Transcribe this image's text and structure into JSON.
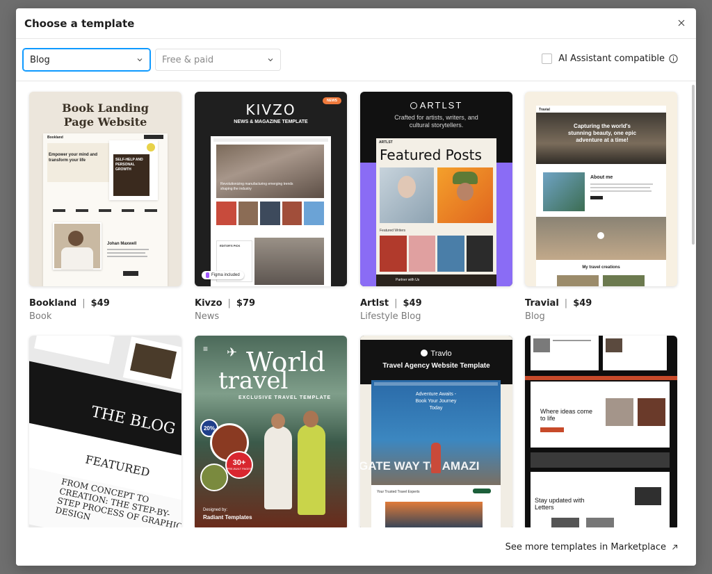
{
  "modal": {
    "title": "Choose a template",
    "close_icon": "close-icon"
  },
  "filters": {
    "category_value": "Blog",
    "price_value": "Free & paid",
    "ai_label": "AI Assistant compatible"
  },
  "templates": [
    {
      "name": "Bookland",
      "price": "$49",
      "category": "Book",
      "thumb": {
        "heading": "Book Landing Page Website",
        "brand": "Bookland",
        "hero": "Empower your mind and transform your life",
        "book_title": "SELF-HELP AND PERSONAL GROWTH",
        "author": "Johan Maxwell"
      }
    },
    {
      "name": "Kivzo",
      "price": "$79",
      "category": "News",
      "thumb": {
        "logo": "KIVZO",
        "subtitle": "NEWS & MAGAZINE TEMPLATE",
        "badge": "NEWS",
        "headline": "Revolutionizing manufacturing emerging trends shaping the industry",
        "editors_pick": "EDITOR'S PICK",
        "figma_badge": "Figma included"
      }
    },
    {
      "name": "Artlst",
      "price": "$49",
      "category": "Lifestyle Blog",
      "thumb": {
        "logo": "ARTLST",
        "tagline": "Crafted for artists, writers, and cultural storytellers.",
        "brand_small": "ARTLST",
        "featured": "Featured Posts",
        "writers": "Featured Writers",
        "partner": "Partner with Us"
      }
    },
    {
      "name": "Travial",
      "price": "$49",
      "category": "Blog",
      "thumb": {
        "brand": "Travial",
        "hero": "Capturing the world's stunning beauty, one epic adventure at a time!",
        "about": "About me",
        "creations": "My travel creations"
      }
    },
    {
      "name": "",
      "price": "",
      "category": "",
      "thumb": {
        "blog": "THE BLOG",
        "featured": "FEATURED",
        "concept": "FROM CONCEPT TO CREATION: THE STEP-BY-STEP PROCESS OF GRAPHIC DESIGN"
      }
    },
    {
      "name": "",
      "price": "",
      "category": "",
      "thumb": {
        "title_a": "World",
        "title_b": "travel",
        "subtitle": "EXCLUSIVE TRAVEL TEMPLATE",
        "badge_pct": "20%",
        "badge_pages": "30+",
        "badge_pages_sub": "PRE-BUILT PAGES",
        "designed_by": "Designed by:",
        "designer": "Radiant Templates"
      }
    },
    {
      "name": "",
      "price": "",
      "category": "",
      "thumb": {
        "logo": "Travlo",
        "subtitle": "Travel Agency Website Template",
        "hero": "Adventure Awaits - Book Your Journey Today",
        "banner": "GATE WAY TO AMAZI",
        "trusted": "Your Trusted Travel Experts"
      }
    },
    {
      "name": "",
      "price": "",
      "category": "",
      "thumb": {
        "ideas": "Where ideas come to life",
        "updated": "Stay updated with Letters"
      }
    }
  ],
  "footer": {
    "link": "See more templates in Marketplace"
  },
  "colors": {
    "accent": "#0d99ff",
    "backdrop": "#6e6e6e"
  }
}
